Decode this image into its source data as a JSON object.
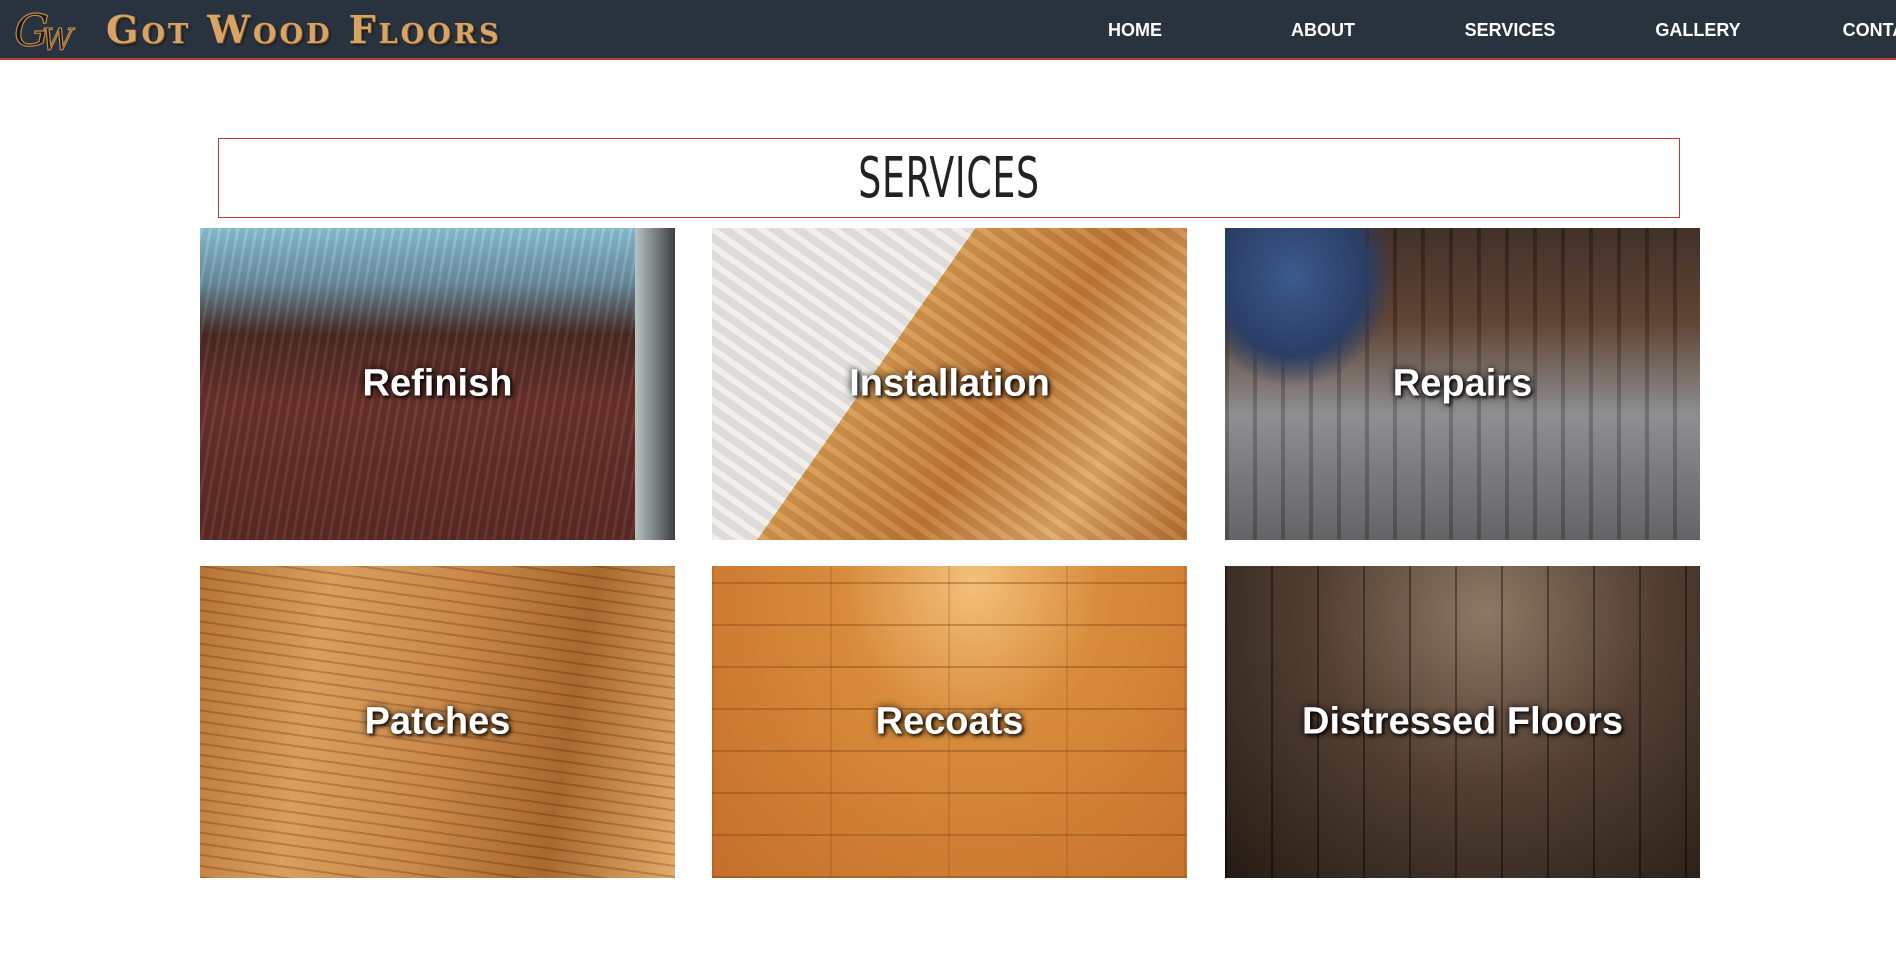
{
  "header": {
    "logo_letters": "GW",
    "brand": "Got Wood Floors",
    "nav": [
      "HOME",
      "ABOUT",
      "SERVICES",
      "GALLERY",
      "CONTACT"
    ]
  },
  "section": {
    "title": "SERVICES"
  },
  "services": [
    {
      "label": "Refinish",
      "image": "refinished-floor-photo"
    },
    {
      "label": "Installation",
      "image": "installation-photo"
    },
    {
      "label": "Repairs",
      "image": "repairs-photo"
    },
    {
      "label": "Patches",
      "image": "wood-grain-photo"
    },
    {
      "label": "Recoats",
      "image": "laminate-floor-photo"
    },
    {
      "label": "Distressed Floors",
      "image": "distressed-wood-photo"
    }
  ],
  "colors": {
    "header_bg": "#28333f",
    "accent": "#c0392b",
    "brand_text": "#d7a468"
  }
}
